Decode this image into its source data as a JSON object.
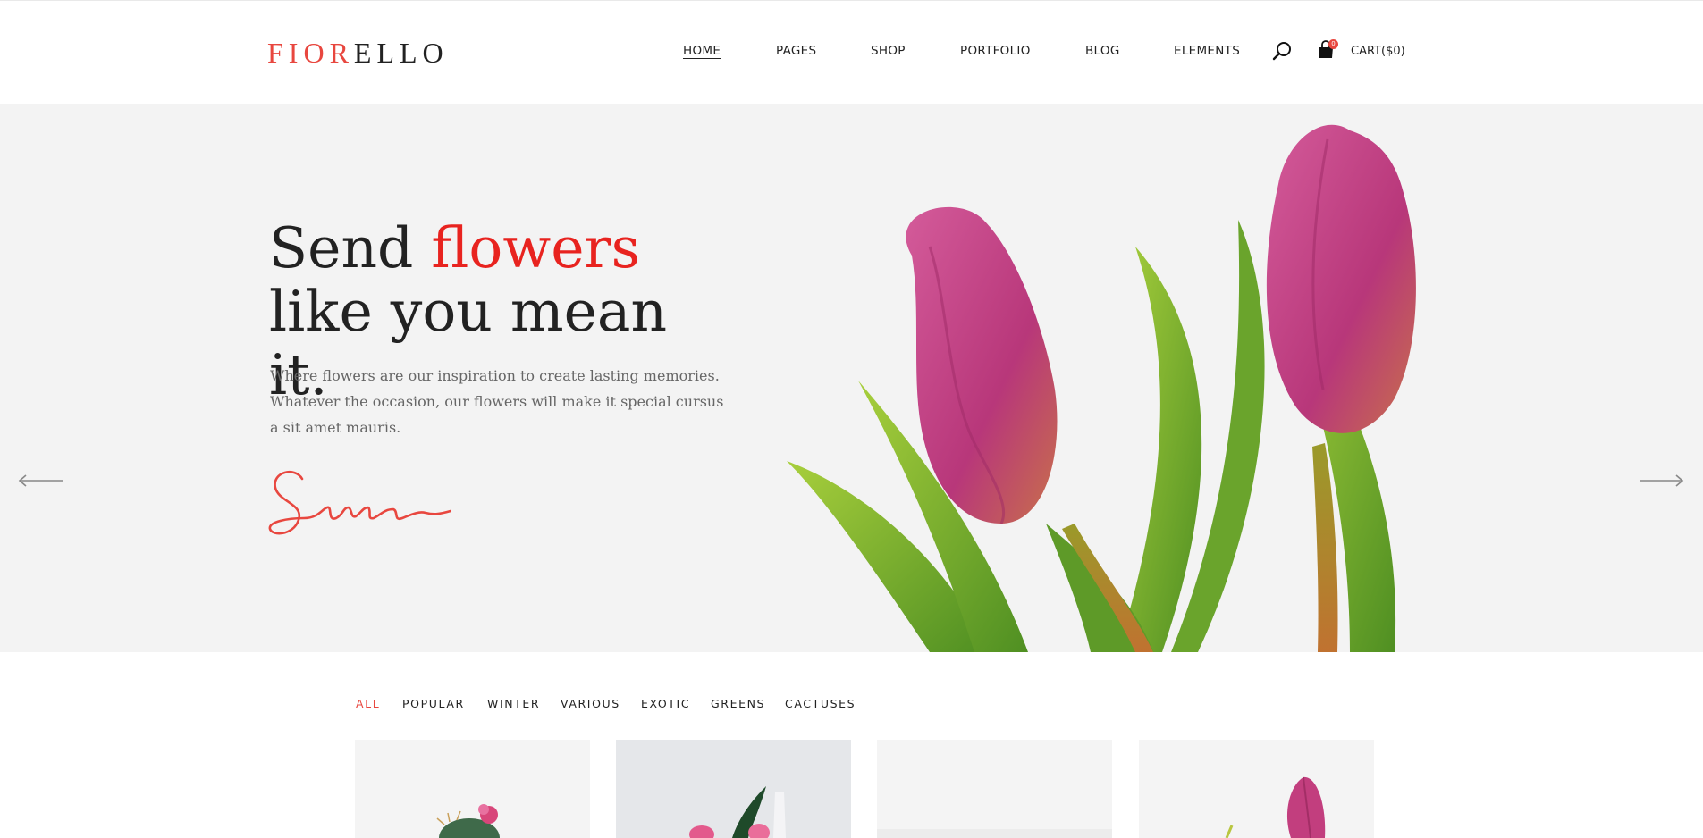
{
  "brand": {
    "logo_part1": "FIOR",
    "logo_part2": "ELLO",
    "accent_color": "#e8473f"
  },
  "nav": {
    "items": [
      {
        "label": "HOME",
        "active": true
      },
      {
        "label": "PAGES"
      },
      {
        "label": "SHOP"
      },
      {
        "label": "PORTFOLIO"
      },
      {
        "label": "BLOG"
      },
      {
        "label": "ELEMENTS"
      }
    ],
    "icons": [
      "search-icon",
      "shopping-bag-icon"
    ],
    "cart_badge": "0",
    "cart_label": "CART($0)"
  },
  "hero": {
    "title_part1": "Send ",
    "title_accent": "flowers",
    "title_part2": " like you mean it.",
    "text": "Where flowers are our inspiration to create lasting memories. Whatever the occasion, our flowers will make it special cursus a sit amet mauris.",
    "signature": "Sara",
    "prev_icon": "arrow-left-icon",
    "next_icon": "arrow-right-icon",
    "background": "#f3f3f3"
  },
  "filters": [
    {
      "label": "ALL",
      "active": true
    },
    {
      "label": "POPULAR"
    },
    {
      "label": "WINTER"
    },
    {
      "label": "VARIOUS"
    },
    {
      "label": "EXOTIC"
    },
    {
      "label": "GREENS"
    },
    {
      "label": "CACTUSES"
    }
  ]
}
